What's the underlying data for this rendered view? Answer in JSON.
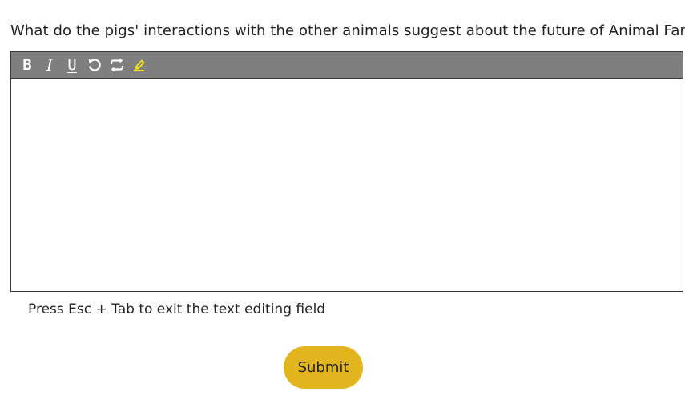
{
  "question": "What do the pigs' interactions with the other animals suggest about the future of Animal Farm?",
  "editor": {
    "toolbar": {
      "bold_label": "B",
      "italic_label": "I",
      "underline_label": "U",
      "undo_icon": "undo-icon",
      "redo_icon": "redo-icon",
      "highlight_icon": "highlighter-icon",
      "highlight_color": "#f2e21a"
    },
    "value": ""
  },
  "hint": "Press Esc + Tab to exit the text editing field",
  "submit_label": "Submit",
  "colors": {
    "toolbar_bg": "#7f7f7f",
    "submit_bg": "#e2b51f"
  }
}
